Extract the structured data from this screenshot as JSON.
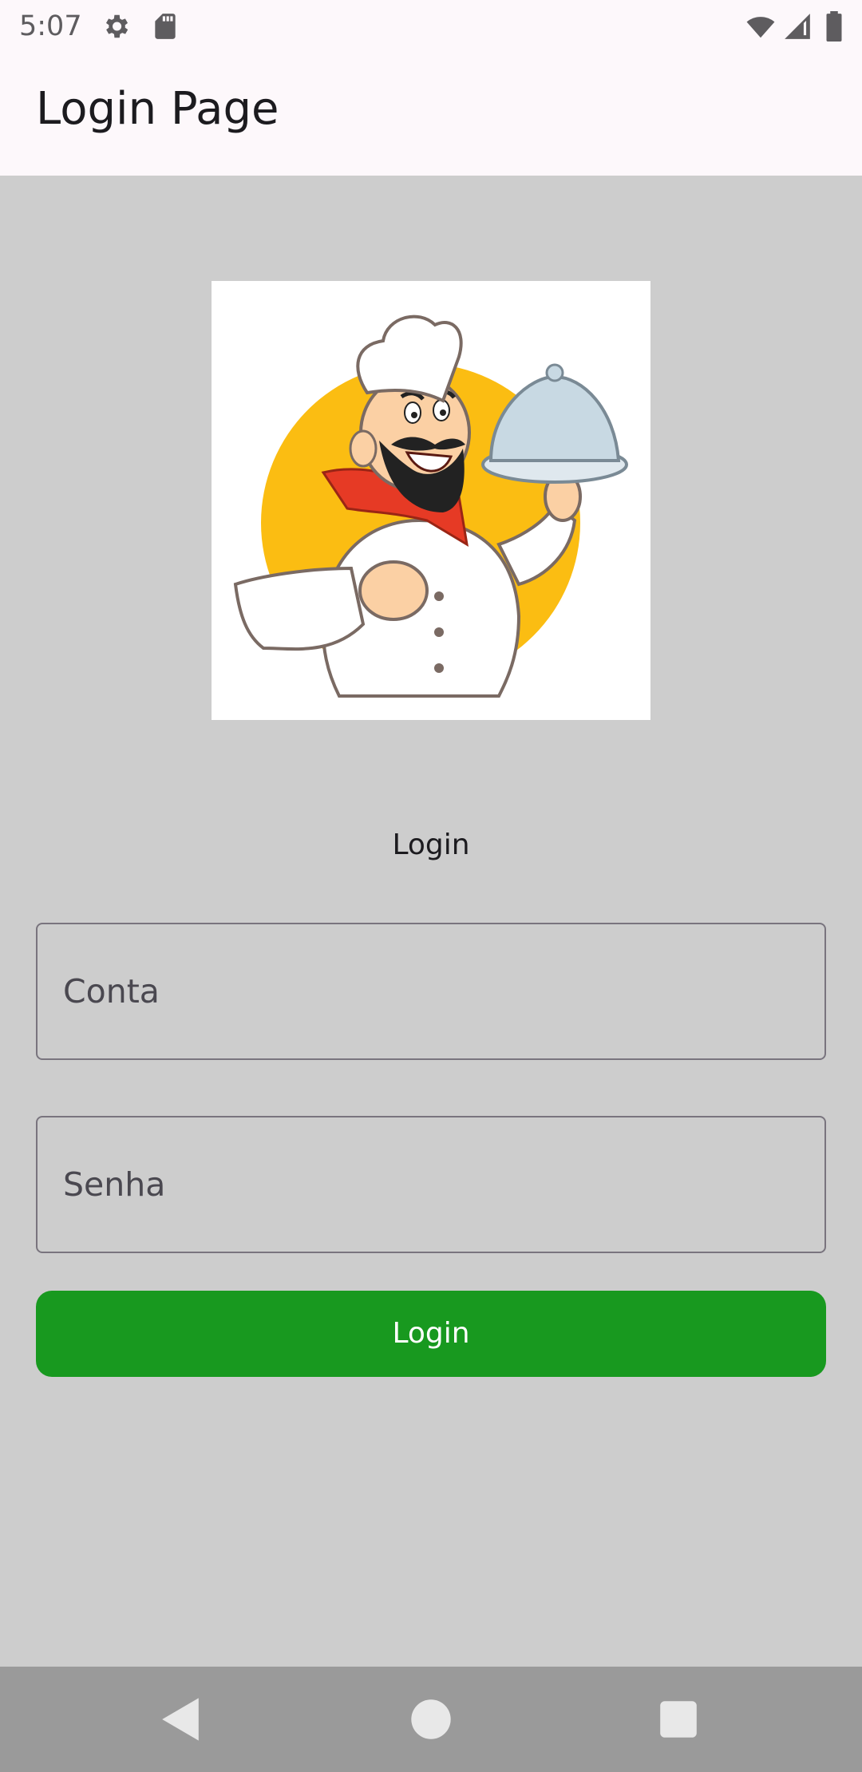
{
  "status_bar": {
    "time": "5:07",
    "icons": [
      "gear-icon",
      "sd-card-icon",
      "wifi-icon",
      "cellular-signal-icon",
      "battery-icon"
    ]
  },
  "app_bar": {
    "title": "Login Page"
  },
  "logo": {
    "icon": "chef-mascot-logo",
    "colors": {
      "circle": "#fbbd12",
      "scarf": "#e63a25",
      "uniform": "#ffffff",
      "outline": "#7a6a63"
    }
  },
  "form": {
    "heading": "Login",
    "account_field": {
      "placeholder": "Conta",
      "value": ""
    },
    "password_field": {
      "placeholder": "Senha",
      "value": ""
    },
    "submit_label": "Login"
  },
  "nav_bar": {
    "buttons": [
      "back-icon",
      "home-icon",
      "recents-icon"
    ]
  },
  "colors": {
    "background": "#cdcdcd",
    "app_bar": "#fdf8fb",
    "button": "#18991f",
    "nav_bar": "#9a9a9a"
  }
}
